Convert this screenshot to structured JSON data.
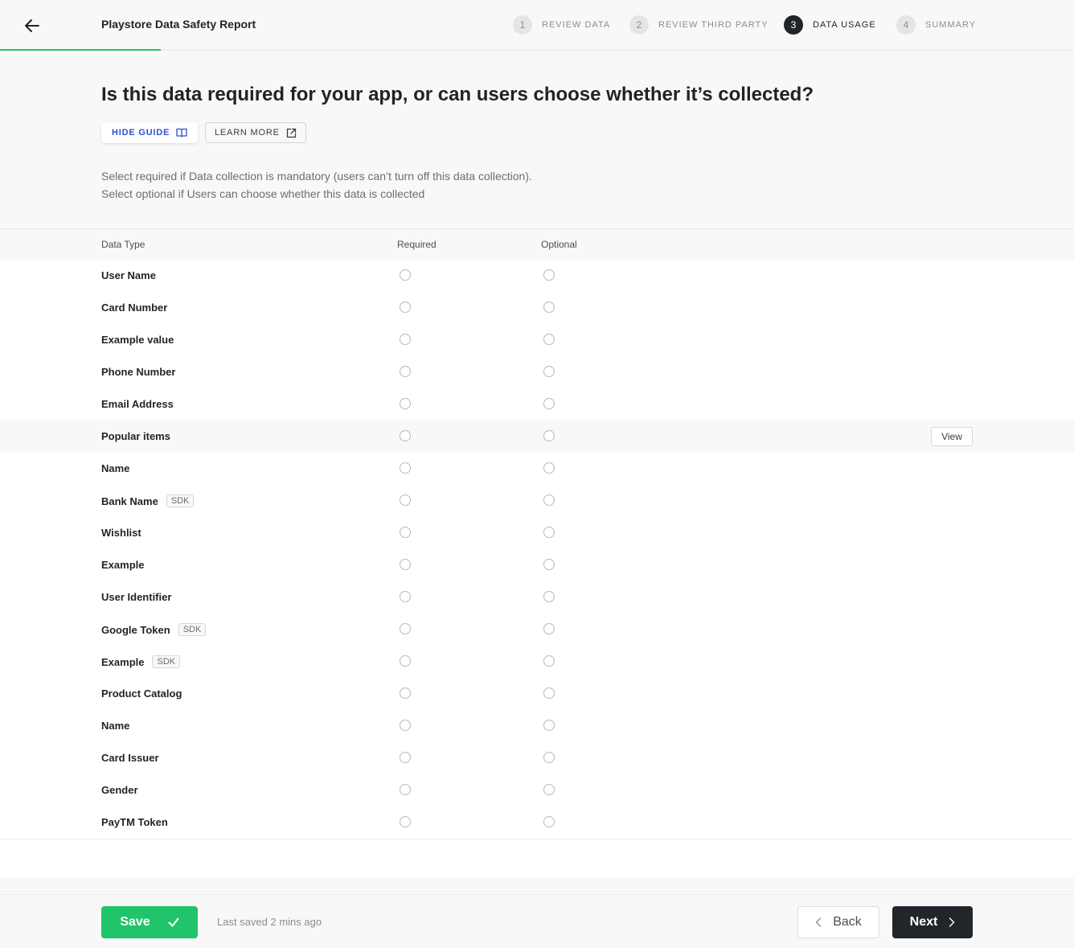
{
  "header": {
    "title": "Playstore Data Safety Report",
    "steps": [
      {
        "num": "1",
        "label": "REVIEW DATA"
      },
      {
        "num": "2",
        "label": "REVIEW THIRD PARTY"
      },
      {
        "num": "3",
        "label": "DATA USAGE"
      },
      {
        "num": "4",
        "label": "SUMMARY"
      }
    ],
    "active_step": 3
  },
  "hero": {
    "question": "Is this data required for your app, or can users choose whether it’s collected?",
    "hide_guide": "HIDE GUIDE",
    "learn_more": "LEARN MORE",
    "desc_line1": "Select required if Data collection is mandatory (users can’t turn off this data collection).",
    "desc_line2": "Select optional if Users can choose whether this data is collected"
  },
  "table": {
    "columns": [
      "Data Type",
      "Required",
      "Optional"
    ],
    "view_label": "View",
    "rows": [
      {
        "name": "User Name"
      },
      {
        "name": "Card Number"
      },
      {
        "name": "Example value"
      },
      {
        "name": "Phone Number"
      },
      {
        "name": "Email Address"
      },
      {
        "name": "Popular items",
        "view": true
      },
      {
        "name": "Name"
      },
      {
        "name": "Bank Name",
        "badge": "SDK"
      },
      {
        "name": "Wishlist"
      },
      {
        "name": "Example"
      },
      {
        "name": "User Identifier"
      },
      {
        "name": "Google Token",
        "badge": "SDK"
      },
      {
        "name": "Example",
        "badge": "SDK"
      },
      {
        "name": "Product Catalog"
      },
      {
        "name": "Name"
      },
      {
        "name": "Card Issuer"
      },
      {
        "name": "Gender"
      },
      {
        "name": "PayTM Token"
      }
    ]
  },
  "footer": {
    "save": "Save",
    "last_saved": "Last saved 2 mins ago",
    "back": "Back",
    "next": "Next"
  },
  "colors": {
    "accent_green": "#21c46b",
    "link_blue": "#2d4fd1",
    "dark": "#22262b"
  }
}
